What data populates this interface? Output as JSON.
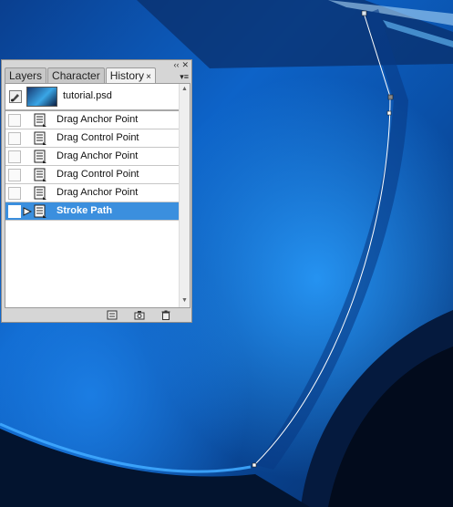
{
  "panel": {
    "tabs": [
      {
        "label": "Layers"
      },
      {
        "label": "Character"
      },
      {
        "label": "History"
      }
    ],
    "tab_close_glyph": "×",
    "snapshot": {
      "label": "tutorial.psd"
    },
    "history": [
      {
        "label": "Drag Anchor Point"
      },
      {
        "label": "Drag Control Point"
      },
      {
        "label": "Drag Anchor Point"
      },
      {
        "label": "Drag Control Point"
      },
      {
        "label": "Drag Anchor Point"
      },
      {
        "label": "Stroke Path"
      }
    ],
    "active_index": 5
  },
  "colors": {
    "selection": "#3b8fde",
    "canvas_blue": "#0b5fc0",
    "path_stroke": "#ffffff"
  },
  "icons": [
    "minimize-icon",
    "close-icon",
    "panel-menu-icon",
    "history-brush-icon",
    "history-state-icon",
    "current-state-marker-icon",
    "new-document-icon",
    "snapshot-camera-icon",
    "trash-icon"
  ]
}
